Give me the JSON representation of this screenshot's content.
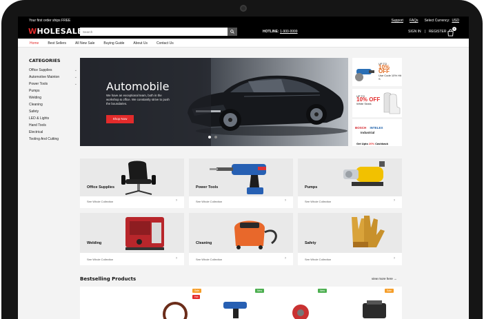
{
  "topbar": {
    "promo": "Your first order ships FREE",
    "support": "Support",
    "faqs": "FAQs",
    "currency_label": "Select Currency:",
    "currency": "USD"
  },
  "header": {
    "logo_w": "W",
    "logo_rest": "HOLESALE",
    "search_placeholder": "Search",
    "hotline_label": "HOTLINE:",
    "hotline_number": "1-900-9999",
    "sign_in": "SIGN IN",
    "separator": "|",
    "register": "REGISTER",
    "cart_count": "0"
  },
  "nav": {
    "items": [
      {
        "label": "Home"
      },
      {
        "label": "Best Sellers"
      },
      {
        "label": "All New Sale"
      },
      {
        "label": "Buying Guide"
      },
      {
        "label": "About Us"
      },
      {
        "label": "Contact Us"
      }
    ]
  },
  "sidebar": {
    "title": "CATEGORIES",
    "items": [
      {
        "label": "Office Supplies",
        "chevron": "⌄"
      },
      {
        "label": "Automotive Mainton",
        "chevron": "⌄"
      },
      {
        "label": "Power Tools",
        "chevron": "⌄"
      },
      {
        "label": "Pumps",
        "chevron": ""
      },
      {
        "label": "Welding",
        "chevron": ""
      },
      {
        "label": "Cleaning",
        "chevron": ""
      },
      {
        "label": "Safety",
        "chevron": ""
      },
      {
        "label": "LED & Lights",
        "chevron": ""
      },
      {
        "label": "Hand Tools",
        "chevron": ""
      },
      {
        "label": "Electrical",
        "chevron": ""
      },
      {
        "label": "Tooling And Cutting",
        "chevron": ""
      }
    ]
  },
  "hero": {
    "title": "Automobile",
    "text": "We have an exceptional team, both in the workshop & office. We constantly strive to push the boundaries.",
    "button": "Shop Now"
  },
  "side_promos": {
    "p1": {
      "up_to": "UP TO",
      "off": "10% OFF",
      "sub": "Use Code 10% Hit S"
    },
    "p2": {
      "up_to": "UP TO",
      "off": "10% OFF",
      "sub": "White Seats"
    },
    "p3": {
      "brand1": "BOSCH",
      "brand2": "INTELEX",
      "brand3": "Industrial",
      "cash_prefix": "Get Upto",
      "cash_pct": "20%",
      "cash_suffix": "Cashback"
    }
  },
  "categories": [
    {
      "name": "Office Supplies",
      "link": "See Whole Collection"
    },
    {
      "name": "Power Tools",
      "link": "See Whole Collection"
    },
    {
      "name": "Pumps",
      "link": "See Whole Collection"
    },
    {
      "name": "Welding",
      "link": "See Whole Collection"
    },
    {
      "name": "Cleaning",
      "link": "See Whole Collection"
    },
    {
      "name": "Safety",
      "link": "See Whole Collection"
    }
  ],
  "bestselling": {
    "title": "Bestselling Products",
    "more": "view more here  →",
    "tags": [
      "Sale",
      "Hot",
      "New",
      "New",
      "Sale"
    ]
  },
  "colors": {
    "accent": "#e32b2b",
    "dark": "#000000"
  }
}
